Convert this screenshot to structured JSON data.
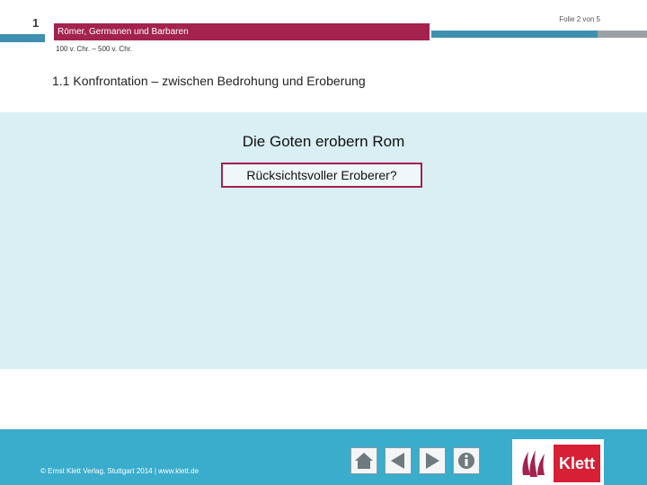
{
  "header": {
    "chapter_number": "1",
    "slide_counter": "Folie 2 von 5",
    "title": "Römer, Germanen und Barbaren",
    "date_range": "100 v. Chr. – 500 v. Chr.",
    "section_heading": "1.1  Konfrontation – zwischen Bedrohung und Eroberung"
  },
  "content": {
    "title": "Die Goten erobern Rom",
    "question": "Rücksichtsvoller Eroberer?"
  },
  "footer": {
    "copyright": "© Ernst Klett Verlag, Stuttgart 2014 | www.klett.de",
    "nav": [
      "home-icon",
      "back-arrow-icon",
      "forward-arrow-icon",
      "info-icon"
    ],
    "logo_text": "Klett"
  },
  "colors": {
    "accent": "#a3224e",
    "bar_blue": "#3f8fb0",
    "panel_bg": "#d9eff3",
    "footer_bg": "#3aaccc",
    "logo_red": "#d71f36"
  }
}
